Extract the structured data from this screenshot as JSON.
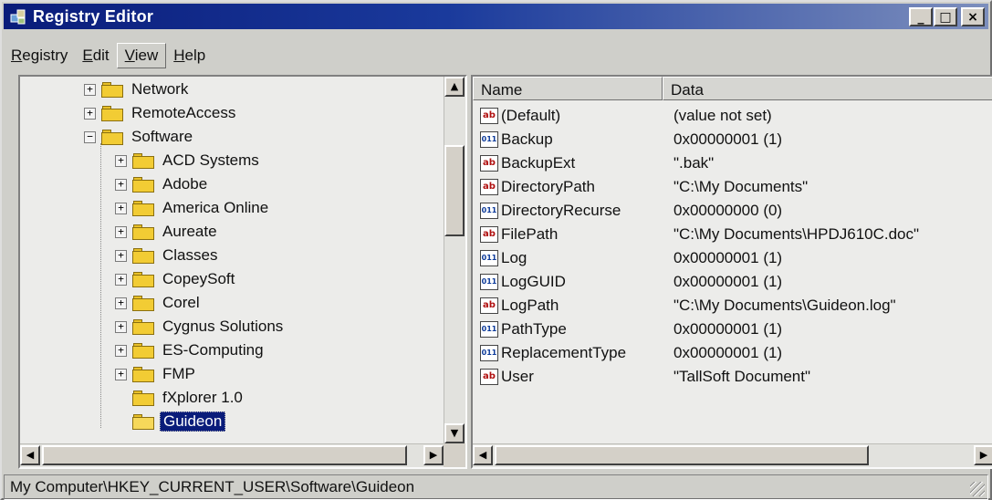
{
  "window": {
    "title": "Registry Editor",
    "controls": {
      "minimize": "_",
      "maximize": "□",
      "close": "×"
    }
  },
  "menu": [
    {
      "label_u": "R",
      "label_rest": "egistry"
    },
    {
      "label_u": "E",
      "label_rest": "dit"
    },
    {
      "label_u": "V",
      "label_rest": "iew"
    },
    {
      "label_u": "H",
      "label_rest": "elp"
    }
  ],
  "tree": {
    "items": [
      {
        "label": "Network",
        "expander": "+",
        "level": 1
      },
      {
        "label": "RemoteAccess",
        "expander": "+",
        "level": 1
      },
      {
        "label": "Software",
        "expander": "−",
        "level": 1
      },
      {
        "label": "ACD Systems",
        "expander": "+",
        "level": 2
      },
      {
        "label": "Adobe",
        "expander": "+",
        "level": 2
      },
      {
        "label": "America Online",
        "expander": "+",
        "level": 2
      },
      {
        "label": "Aureate",
        "expander": "+",
        "level": 2
      },
      {
        "label": "Classes",
        "expander": "+",
        "level": 2
      },
      {
        "label": "CopeySoft",
        "expander": "+",
        "level": 2
      },
      {
        "label": "Corel",
        "expander": "+",
        "level": 2
      },
      {
        "label": "Cygnus Solutions",
        "expander": "+",
        "level": 2
      },
      {
        "label": "ES-Computing",
        "expander": "+",
        "level": 2
      },
      {
        "label": "FMP",
        "expander": "+",
        "level": 2
      },
      {
        "label": "fXplorer 1.0",
        "expander": "",
        "level": 2
      },
      {
        "label": "Guideon",
        "expander": "",
        "level": 2,
        "selected": true
      }
    ]
  },
  "list": {
    "columns": {
      "name": "Name",
      "data": "Data"
    },
    "rows": [
      {
        "icon": "ab",
        "type": "string",
        "name": "(Default)",
        "data": "(value not set)"
      },
      {
        "icon": "011\n110",
        "type": "dword",
        "name": "Backup",
        "data": "0x00000001 (1)"
      },
      {
        "icon": "ab",
        "type": "string",
        "name": "BackupExt",
        "data": "\".bak\""
      },
      {
        "icon": "ab",
        "type": "string",
        "name": "DirectoryPath",
        "data": "\"C:\\My Documents\""
      },
      {
        "icon": "011\n110",
        "type": "dword",
        "name": "DirectoryRecurse",
        "data": "0x00000000 (0)"
      },
      {
        "icon": "ab",
        "type": "string",
        "name": "FilePath",
        "data": "\"C:\\My Documents\\HPDJ610C.doc\""
      },
      {
        "icon": "011\n110",
        "type": "dword",
        "name": "Log",
        "data": "0x00000001 (1)"
      },
      {
        "icon": "011\n110",
        "type": "dword",
        "name": "LogGUID",
        "data": "0x00000001 (1)"
      },
      {
        "icon": "ab",
        "type": "string",
        "name": "LogPath",
        "data": "\"C:\\My Documents\\Guideon.log\""
      },
      {
        "icon": "011\n110",
        "type": "dword",
        "name": "PathType",
        "data": "0x00000001 (1)"
      },
      {
        "icon": "011\n110",
        "type": "dword",
        "name": "ReplacementType",
        "data": "0x00000001 (1)"
      },
      {
        "icon": "ab",
        "type": "string",
        "name": "User",
        "data": "\"TallSoft Document\""
      }
    ]
  },
  "status": {
    "path": "My Computer\\HKEY_CURRENT_USER\\Software\\Guideon"
  },
  "colors": {
    "titlebar": "#0a1c7a",
    "selection": "#0a1c7a",
    "window": "#cfcfca"
  },
  "icons": {
    "app": "registry-editor-icon",
    "folder": "folder-icon",
    "string_value": "string-value-icon",
    "dword_value": "binary-value-icon"
  }
}
